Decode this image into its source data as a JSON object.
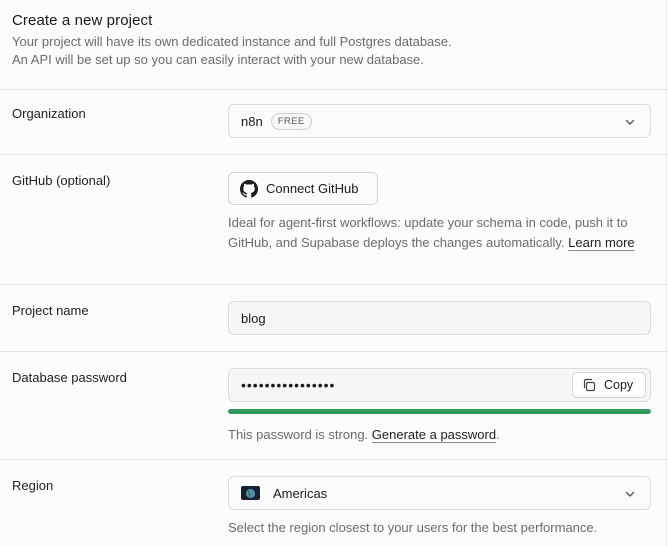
{
  "header": {
    "title": "Create a new project",
    "subtitle_line1": "Your project will have its own dedicated instance and full Postgres database.",
    "subtitle_line2": "An API will be set up so you can easily interact with your new database."
  },
  "organization": {
    "label": "Organization",
    "value": "n8n",
    "badge": "FREE"
  },
  "github": {
    "label": "GitHub (optional)",
    "button_label": "Connect GitHub",
    "description": "Ideal for agent-first workflows: update your schema in code, push it to GitHub, and Supabase deploys the changes automatically.",
    "learn_more": "Learn more"
  },
  "project_name": {
    "label": "Project name",
    "value": "blog"
  },
  "database_password": {
    "label": "Database password",
    "value": "••••••••••••••••",
    "copy_label": "Copy",
    "strength_percent": 100,
    "strength_color": "#2f9b5b",
    "strength_text": "This password is strong.",
    "generate_link": "Generate a password",
    "trailing_period": "."
  },
  "region": {
    "label": "Region",
    "value": "Americas",
    "description": "Select the region closest to your users for the best performance."
  }
}
